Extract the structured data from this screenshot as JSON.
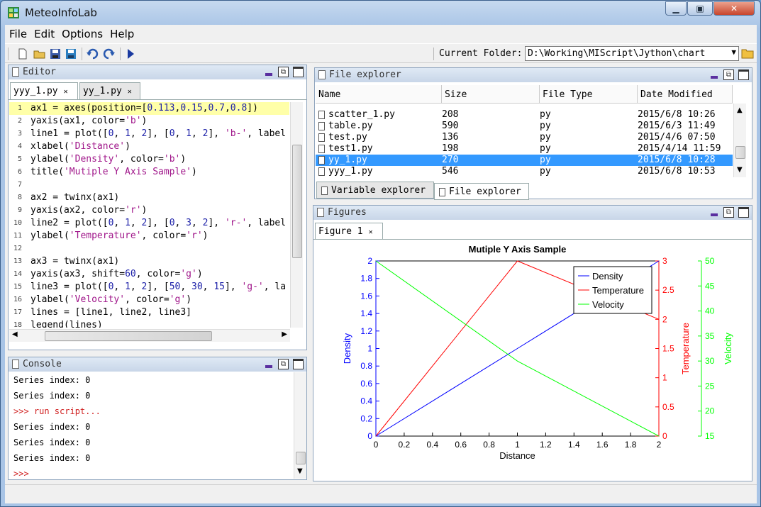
{
  "window": {
    "title": "MeteoInfoLab"
  },
  "menu": [
    "File",
    "Edit",
    "Options",
    "Help"
  ],
  "toolbar": {
    "folder_label": "Current Folder:",
    "folder_path": "D:\\Working\\MIScript\\Jython\\chart"
  },
  "editor": {
    "title": "Editor",
    "tabs": [
      "yyy_1.py",
      "yy_1.py"
    ],
    "lines": [
      {
        "n": "1",
        "parts": [
          [
            "t",
            "ax1 = axes(position=["
          ],
          [
            "n",
            "0.113"
          ],
          [
            "t",
            ","
          ],
          [
            "n",
            "0.15"
          ],
          [
            "t",
            ","
          ],
          [
            "n",
            "0.7"
          ],
          [
            "t",
            ","
          ],
          [
            "n",
            "0.8"
          ],
          [
            "t",
            "])"
          ]
        ]
      },
      {
        "n": "2",
        "parts": [
          [
            "t",
            "yaxis(ax1, color="
          ],
          [
            "s",
            "'b'"
          ],
          [
            "t",
            ")"
          ]
        ]
      },
      {
        "n": "3",
        "parts": [
          [
            "t",
            "line1 = plot(["
          ],
          [
            "n",
            "0"
          ],
          [
            "t",
            ", "
          ],
          [
            "n",
            "1"
          ],
          [
            "t",
            ", "
          ],
          [
            "n",
            "2"
          ],
          [
            "t",
            "], ["
          ],
          [
            "n",
            "0"
          ],
          [
            "t",
            ", "
          ],
          [
            "n",
            "1"
          ],
          [
            "t",
            ", "
          ],
          [
            "n",
            "2"
          ],
          [
            "t",
            "], "
          ],
          [
            "s",
            "'b-'"
          ],
          [
            "t",
            ", label"
          ]
        ]
      },
      {
        "n": "4",
        "parts": [
          [
            "t",
            "xlabel("
          ],
          [
            "s",
            "'Distance'"
          ],
          [
            "t",
            ")"
          ]
        ]
      },
      {
        "n": "5",
        "parts": [
          [
            "t",
            "ylabel("
          ],
          [
            "s",
            "'Density'"
          ],
          [
            "t",
            ", color="
          ],
          [
            "s",
            "'b'"
          ],
          [
            "t",
            ")"
          ]
        ]
      },
      {
        "n": "6",
        "parts": [
          [
            "t",
            "title("
          ],
          [
            "s",
            "'Mutiple Y Axis Sample'"
          ],
          [
            "t",
            ")"
          ]
        ]
      },
      {
        "n": "7",
        "parts": []
      },
      {
        "n": "8",
        "parts": [
          [
            "t",
            "ax2 = twinx(ax1)"
          ]
        ]
      },
      {
        "n": "9",
        "parts": [
          [
            "t",
            "yaxis(ax2, color="
          ],
          [
            "s",
            "'r'"
          ],
          [
            "t",
            ")"
          ]
        ]
      },
      {
        "n": "10",
        "parts": [
          [
            "t",
            "line2 = plot(["
          ],
          [
            "n",
            "0"
          ],
          [
            "t",
            ", "
          ],
          [
            "n",
            "1"
          ],
          [
            "t",
            ", "
          ],
          [
            "n",
            "2"
          ],
          [
            "t",
            "], ["
          ],
          [
            "n",
            "0"
          ],
          [
            "t",
            ", "
          ],
          [
            "n",
            "3"
          ],
          [
            "t",
            ", "
          ],
          [
            "n",
            "2"
          ],
          [
            "t",
            "], "
          ],
          [
            "s",
            "'r-'"
          ],
          [
            "t",
            ", label"
          ]
        ]
      },
      {
        "n": "11",
        "parts": [
          [
            "t",
            "ylabel("
          ],
          [
            "s",
            "'Temperature'"
          ],
          [
            "t",
            ", color="
          ],
          [
            "s",
            "'r'"
          ],
          [
            "t",
            ")"
          ]
        ]
      },
      {
        "n": "12",
        "parts": []
      },
      {
        "n": "13",
        "parts": [
          [
            "t",
            "ax3 = twinx(ax1)"
          ]
        ]
      },
      {
        "n": "14",
        "parts": [
          [
            "t",
            "yaxis(ax3, shift="
          ],
          [
            "n",
            "60"
          ],
          [
            "t",
            ", color="
          ],
          [
            "s",
            "'g'"
          ],
          [
            "t",
            ")"
          ]
        ]
      },
      {
        "n": "15",
        "parts": [
          [
            "t",
            "line3 = plot(["
          ],
          [
            "n",
            "0"
          ],
          [
            "t",
            ", "
          ],
          [
            "n",
            "1"
          ],
          [
            "t",
            ", "
          ],
          [
            "n",
            "2"
          ],
          [
            "t",
            "], ["
          ],
          [
            "n",
            "50"
          ],
          [
            "t",
            ", "
          ],
          [
            "n",
            "30"
          ],
          [
            "t",
            ", "
          ],
          [
            "n",
            "15"
          ],
          [
            "t",
            "], "
          ],
          [
            "s",
            "'g-'"
          ],
          [
            "t",
            ", la"
          ]
        ]
      },
      {
        "n": "16",
        "parts": [
          [
            "t",
            "ylabel("
          ],
          [
            "s",
            "'Velocity'"
          ],
          [
            "t",
            ", color="
          ],
          [
            "s",
            "'g'"
          ],
          [
            "t",
            ")"
          ]
        ]
      },
      {
        "n": "17",
        "parts": [
          [
            "t",
            "lines = [line1, line2, line3]"
          ]
        ]
      },
      {
        "n": "18",
        "parts": [
          [
            "t",
            "legend(lines)"
          ]
        ]
      }
    ]
  },
  "console": {
    "title": "Console",
    "lines": [
      "Series index: 0",
      "Series index: 0",
      ">>> run script...",
      "Series index: 0",
      "Series index: 0",
      "Series index: 0",
      ">>>"
    ]
  },
  "file_explorer": {
    "title": "File explorer",
    "columns": [
      "Name",
      "Size",
      "File Type",
      "Date Modified"
    ],
    "rows": [
      {
        "name": "scatter_1.py",
        "size": "208",
        "type": "py",
        "date": "2015/6/8 10:26"
      },
      {
        "name": "table.py",
        "size": "590",
        "type": "py",
        "date": "2015/6/3 11:49"
      },
      {
        "name": "test.py",
        "size": "136",
        "type": "py",
        "date": "2015/4/6 07:50"
      },
      {
        "name": "test1.py",
        "size": "198",
        "type": "py",
        "date": "2015/4/14 11:59"
      },
      {
        "name": "yy_1.py",
        "size": "270",
        "type": "py",
        "date": "2015/6/8 10:28"
      },
      {
        "name": "yyy_1.py",
        "size": "546",
        "type": "py",
        "date": "2015/6/8 10:53"
      }
    ],
    "selected_row": 4,
    "bottom_tabs": [
      "Variable explorer",
      "File explorer"
    ]
  },
  "figures": {
    "title": "Figures",
    "tab": "Figure 1"
  },
  "colors": {
    "density": "#0000ff",
    "temperature": "#ff0000",
    "velocity": "#00ff00",
    "selection": "#3399ff"
  },
  "chart_data": {
    "type": "line",
    "title": "Mutiple Y Axis Sample",
    "xlabel": "Distance",
    "x": [
      0,
      1,
      2
    ],
    "xlim": [
      0,
      2
    ],
    "xticks": [
      "0",
      "0.2",
      "0.4",
      "0.6",
      "0.8",
      "1",
      "1.2",
      "1.4",
      "1.6",
      "1.8",
      "2"
    ],
    "legend_position": "top-right",
    "grid": false,
    "axes": [
      {
        "ylabel": "Density",
        "color": "#0000ff",
        "ylim": [
          0,
          2
        ],
        "side": "left",
        "ticks": [
          "0",
          "0.2",
          "0.4",
          "0.6",
          "0.8",
          "1",
          "1.2",
          "1.4",
          "1.6",
          "1.8",
          "2"
        ]
      },
      {
        "ylabel": "Temperature",
        "color": "#ff0000",
        "ylim": [
          0,
          3
        ],
        "side": "right",
        "ticks": [
          "0",
          "0.5",
          "1",
          "1.5",
          "2",
          "2.5",
          "3"
        ]
      },
      {
        "ylabel": "Velocity",
        "color": "#00ff00",
        "ylim": [
          15,
          50
        ],
        "side": "right-shifted",
        "ticks": [
          "15",
          "20",
          "25",
          "30",
          "35",
          "40",
          "45",
          "50"
        ]
      }
    ],
    "series": [
      {
        "name": "Density",
        "axis": 0,
        "values": [
          0,
          1,
          2
        ]
      },
      {
        "name": "Temperature",
        "axis": 1,
        "values": [
          0,
          3,
          2
        ]
      },
      {
        "name": "Velocity",
        "axis": 2,
        "values": [
          50,
          30,
          15
        ]
      }
    ]
  }
}
